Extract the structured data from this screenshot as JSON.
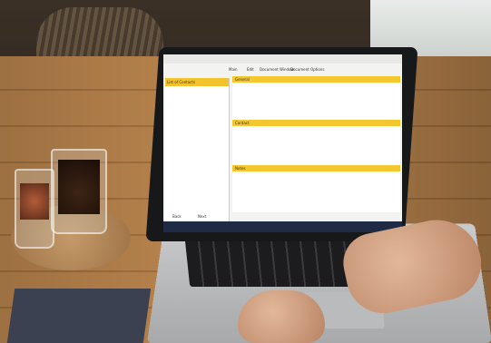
{
  "scene": {
    "description_tags": [
      "laptop",
      "wooden-table",
      "tea-glasses",
      "hands-typing"
    ]
  },
  "screen": {
    "tabs": [
      "Main",
      "Edit",
      "Document Window",
      "Document Options"
    ],
    "sidebar_title": "List of Contacts",
    "main_section_1": "General",
    "main_section_2": "Contact",
    "main_section_3": "Notes",
    "bottom_buttons": [
      "Back",
      "Next"
    ]
  }
}
